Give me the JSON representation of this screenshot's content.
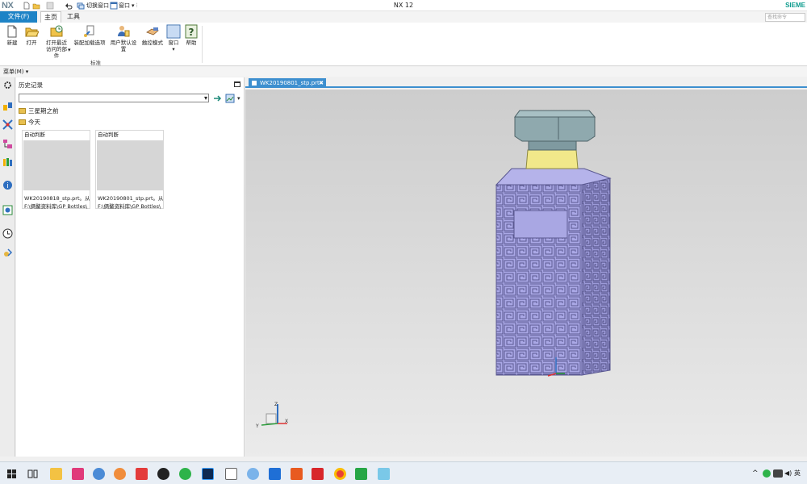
{
  "app": {
    "logo": "NX",
    "title": "NX 12",
    "brand": "SIEME"
  },
  "quick_access": {
    "switch_window": "切换窗口",
    "window": "窗口"
  },
  "tabs": {
    "file": "文件(F)",
    "home": "主页",
    "tools": "工具"
  },
  "command_finder": {
    "placeholder": "查找命令"
  },
  "ribbon": {
    "buttons": [
      {
        "label": "新建",
        "icon": "new-file-icon"
      },
      {
        "label": "打开",
        "icon": "open-folder-icon"
      },
      {
        "label": "打开最近访问的部件",
        "icon": "recent-parts-icon"
      },
      {
        "label": "装配加载选项",
        "icon": "assembly-load-icon"
      },
      {
        "label": "用户默认设置",
        "icon": "user-defaults-icon"
      },
      {
        "label": "触控模式",
        "icon": "touch-mode-icon"
      },
      {
        "label": "窗口",
        "icon": "window-icon"
      },
      {
        "label": "帮助",
        "icon": "help-icon"
      }
    ],
    "group_label": "标准"
  },
  "menubar": {
    "menu": "菜单(M) ▾"
  },
  "history": {
    "title": "历史记录",
    "folders": [
      "三星期之前",
      "今天"
    ],
    "cards": [
      {
        "header": "自动判断",
        "line1": "WK20190818_stp.prt。从",
        "line2": "F:\\俩鳌资料库\\GP Bottles\\"
      },
      {
        "header": "自动判断",
        "line1": "WK20190801_stp.prt。从",
        "line2": "F:\\俩鳌资料库\\GP Bottles\\"
      }
    ]
  },
  "graphics": {
    "tab_label": "WK20190801_stp.prt",
    "close": "✖"
  },
  "taskbar": {
    "ime": "英"
  },
  "colors": {
    "accent": "#1e83c6",
    "bottle_body": "#aaa8e6",
    "bottle_band": "#f1e88a",
    "bottle_cap": "#8aa4a9"
  }
}
